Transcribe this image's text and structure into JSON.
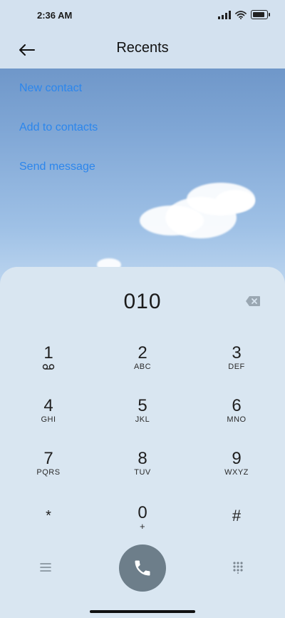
{
  "status_bar": {
    "time": "2:36 AM"
  },
  "app_bar": {
    "title": "Recents"
  },
  "actions": [
    {
      "label": "New contact"
    },
    {
      "label": "Add to contacts"
    },
    {
      "label": "Send message"
    }
  ],
  "dialer": {
    "number": "010",
    "keys": [
      {
        "digit": "1",
        "letters": ""
      },
      {
        "digit": "2",
        "letters": "ABC"
      },
      {
        "digit": "3",
        "letters": "DEF"
      },
      {
        "digit": "4",
        "letters": "GHI"
      },
      {
        "digit": "5",
        "letters": "JKL"
      },
      {
        "digit": "6",
        "letters": "MNO"
      },
      {
        "digit": "7",
        "letters": "PQRS"
      },
      {
        "digit": "8",
        "letters": "TUV"
      },
      {
        "digit": "9",
        "letters": "WXYZ"
      },
      {
        "digit": "*",
        "letters": ""
      },
      {
        "digit": "0",
        "letters": "+"
      },
      {
        "digit": "#",
        "letters": ""
      }
    ]
  },
  "colors": {
    "accent": "#2c86ec",
    "call_button": "#6d7e8a",
    "panel": "#d9e6f1"
  },
  "icons": {
    "back": "arrow-left-icon",
    "backspace": "backspace-icon",
    "voicemail": "voicemail-icon",
    "menu": "menu-icon",
    "call": "phone-icon",
    "keypad": "dialpad-icon"
  }
}
